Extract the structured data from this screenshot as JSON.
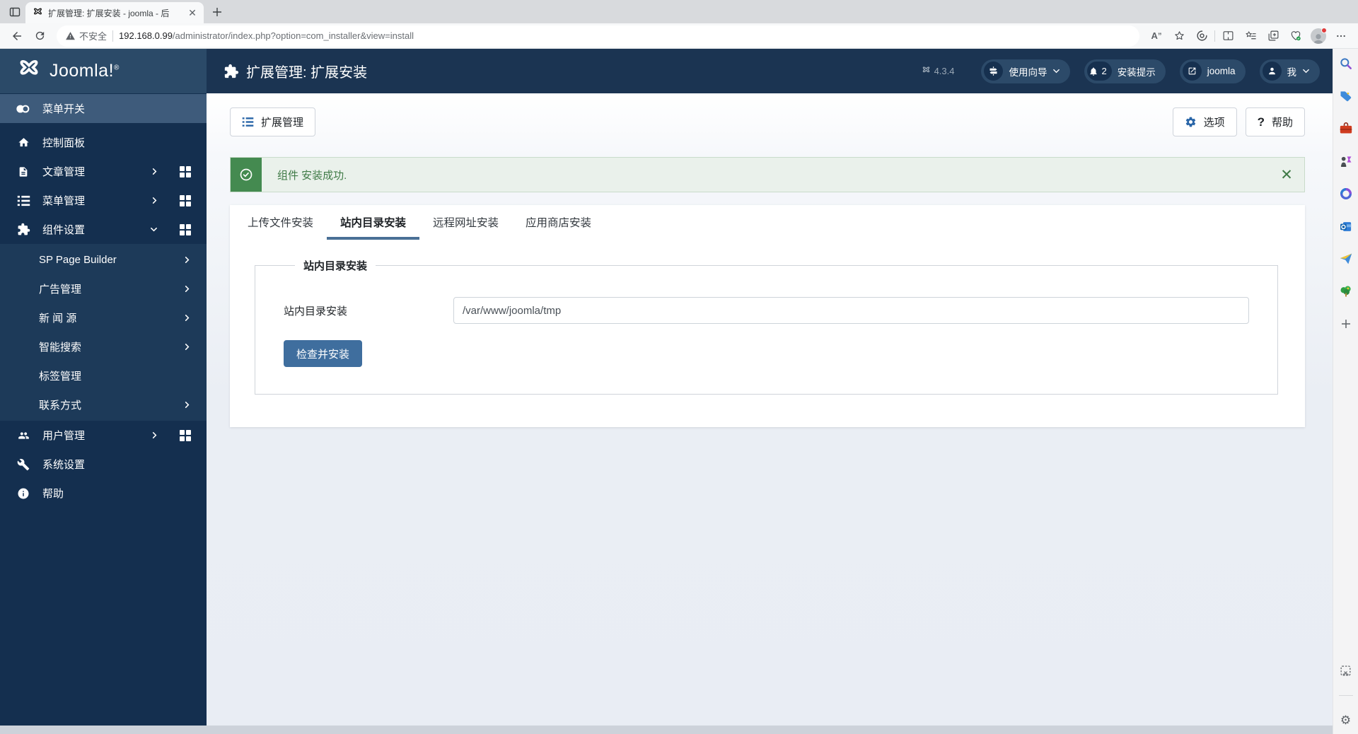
{
  "browser": {
    "tab_title": "扩展管理: 扩展安装 - joomla - 后",
    "not_secure": "不安全",
    "url_domain": "192.168.0.99",
    "url_path": "/administrator/index.php?option=com_installer&view=install"
  },
  "header": {
    "logo": "Joomla!",
    "page_title": "扩展管理: 扩展安装",
    "version": "4.3.4",
    "guide_pill": "使用向导",
    "notice_badge": "2",
    "notice_pill": "安装提示",
    "site_pill": "joomla",
    "me_pill": "我"
  },
  "sidebar": {
    "items": [
      {
        "label": "菜单开关"
      },
      {
        "label": "控制面板"
      },
      {
        "label": "文章管理"
      },
      {
        "label": "菜单管理"
      },
      {
        "label": "组件设置"
      },
      {
        "label": "用户管理"
      },
      {
        "label": "系统设置"
      },
      {
        "label": "帮助"
      }
    ],
    "submenu": [
      {
        "label": "SP Page Builder"
      },
      {
        "label": "广告管理"
      },
      {
        "label": "新 闻 源"
      },
      {
        "label": "智能搜索"
      },
      {
        "label": "标签管理"
      },
      {
        "label": "联系方式"
      }
    ]
  },
  "toolbar": {
    "manage_button": "扩展管理",
    "options_button": "选项",
    "help_button": "帮助"
  },
  "alert": {
    "message": "组件 安装成功."
  },
  "tabs": [
    {
      "label": "上传文件安装"
    },
    {
      "label": "站内目录安装"
    },
    {
      "label": "远程网址安装"
    },
    {
      "label": "应用商店安装"
    }
  ],
  "form": {
    "legend": "站内目录安装",
    "field_label": "站内目录安装",
    "field_value": "/var/www/joomla/tmp",
    "submit_label": "检查并安装"
  },
  "colors": {
    "header_navy": "#1b3452",
    "logo_blue": "#2b4a68",
    "sidebar_navy": "#142f4f",
    "active_item_blue": "#3e5b7b",
    "submenu_navy": "#1d3a59",
    "accent_blue": "#2a66a8",
    "button_blue": "#3f6e9e",
    "success_green": "#448a50",
    "tab_underline_blue": "#4a7096"
  }
}
